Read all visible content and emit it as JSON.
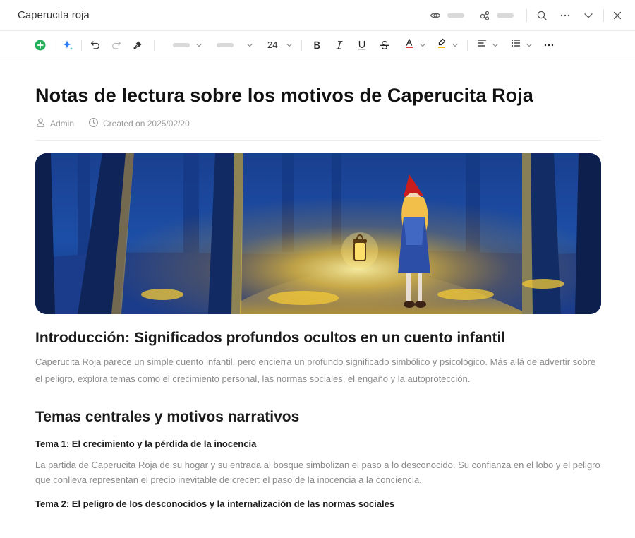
{
  "window": {
    "title": "Caperucita roja"
  },
  "toolbar": {
    "font_size": "24"
  },
  "article": {
    "title": "Notas de lectura sobre los motivos de Caperucita Roja",
    "author": "Admin",
    "created": "Created on 2025/02/20",
    "hero_image": "Girl in red hood walking with a glowing lantern through a dark blue forest",
    "intro_heading": "Introducción: Significados profundos ocultos en un cuento infantil",
    "intro_text": "Caperucita Roja parece un simple cuento infantil, pero encierra un profundo significado simbólico y psicológico. Más allá de advertir sobre el peligro, explora temas como el crecimiento personal, las normas sociales, el engaño y la autoprotección.",
    "themes_heading": "Temas centrales y motivos narrativos",
    "theme1_heading": "Tema 1: El crecimiento y la pérdida de la inocencia",
    "theme1_text": "La partida de Caperucita Roja de su hogar y su entrada al bosque simbolizan el paso a lo desconocido. Su confianza en el lobo y el peligro que conlleva representan el precio inevitable de crecer: el paso de la inocencia a la conciencia.",
    "theme2_heading": "Tema 2: El peligro de los desconocidos y la internalización de las normas sociales"
  },
  "colors": {
    "accent_green": "#21b15a",
    "ai_blue": "#2f7df6",
    "font_color_underline": "#e53935",
    "highlight_underline": "#f5b800"
  }
}
